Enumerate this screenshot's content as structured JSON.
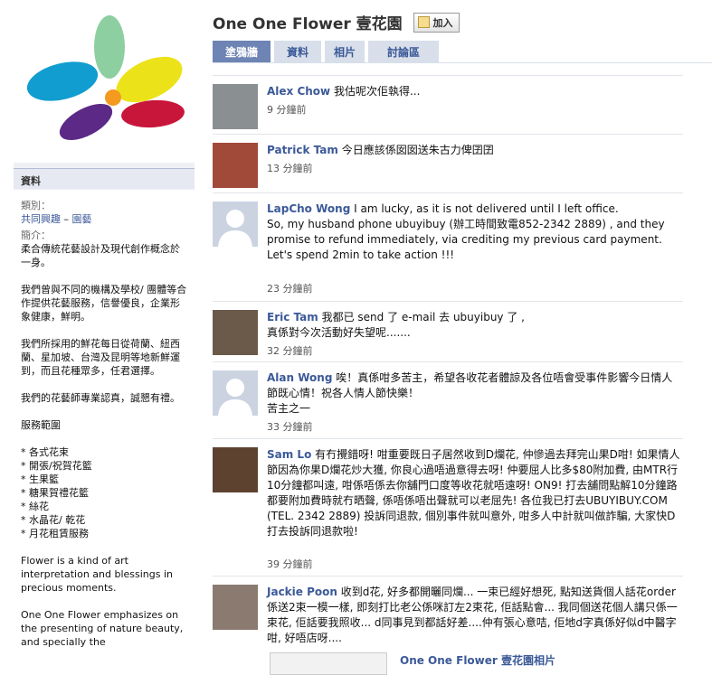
{
  "page": {
    "title": "One One Flower 壹花園",
    "join_label": "加入"
  },
  "tabs": [
    "塗鴉牆",
    "資料",
    "相片",
    "討論區"
  ],
  "info": {
    "header": "資料",
    "category_label": "類別：",
    "category_link1": "共同興趣",
    "category_sep": " – ",
    "category_link2": "園藝",
    "intro_label": "簡介：",
    "paragraphs": [
      "柔合傳統花藝設計及現代創作概念於一身。",
      "我們曾與不同的機構及學校/ 團體等合作提供花藝服務，信譽優良，企業形象健康，鮮明。",
      "我們所採用的鮮花每日從荷蘭、紐西蘭、星加坡、台灣及昆明等地新鮮運到，而且花種眾多，任君選擇。",
      "我們的花藝師專業認真，誠懇有禮。",
      "服務範圍",
      "* 各式花束\n* 開張/祝賀花籃\n* 生果籃\n* 糖果賀禮花籃\n* 絲花\n* 水晶花/ 乾花\n* 月花租賃服務",
      "Flower is a kind of art interpretation and blessings in precious moments.",
      "One One Flower emphasizes on the presenting of nature beauty, and specially the"
    ]
  },
  "posts": [
    {
      "name": "Alex Chow",
      "text": "我估呢次佢執得...",
      "time": "9 分鐘前"
    },
    {
      "name": "Patrick Tam",
      "text": "今日應該係囡囡送朱古力俾囝囝",
      "time": "13 分鐘前"
    },
    {
      "name": "LapCho Wong",
      "text": "I am lucky, as it is not delivered until I left office.\nSo, my husband phone ubuyibuy (辦工時間致電852-2342 2889) , and they promise to refund immediately, via crediting my previous card payment.\nLet's spend 2min to take action !!!",
      "time": "23 分鐘前"
    },
    {
      "name": "Eric Tam",
      "text": "我都已 send 了 e-mail 去 ubuyibuy 了 ,\n真係對今次活動好失望呢.......",
      "time": "32 分鐘前"
    },
    {
      "name": "Alan Wong",
      "text": "唉！真係咁多苦主，希望各收花者體諒及各位唔會受事件影響今日情人節既心情！祝各人情人節快樂！\n苦主之一",
      "time": "33 分鐘前"
    },
    {
      "name": "Sam Lo",
      "text": "有冇攪錯呀! 咁重要既日子居然收到D爛花, 仲慘過去拜完山果D咁! 如果情人節因為你果D爛花炒大獲, 你良心過唔過意得去呀! 仲要屈人比多$80附加費, 由MTR行10分鐘都叫遠, 咁係唔係去你舖門口度等收花就唔遠呀! ON9! 打去舖問點解10分鐘路都要附加費時就冇晒聲, 係唔係唔出聲就可以老屈先! 各位我已打去UBUYIBUY.COM (TEL. 2342 2889) 投訴同退款, 個別事件就叫意外, 咁多人中計就叫做詐騙, 大家快D打去投訴同退款啦!",
      "time": "39 分鐘前"
    },
    {
      "name": "Jackie Poon",
      "text": "收到d花, 好多都開曬同爛... 一束已經好想死, 點知送貨個人話花order 係送2束一模一樣, 即刻打比老公係咪訂左2束花, 佢話點會... 我同個送花個人講只係一束花, 佢話要我照收... d同事見到都話好差....仲有張心意咭, 佢地d字真係好似d中醫字咁, 好唔店呀....",
      "time": ""
    }
  ],
  "album_link": "One One Flower 壹花園相片",
  "colors": {
    "link": "#3b5998",
    "tab_active": "#6d84b4",
    "tab_inactive": "#d8dfea",
    "sidebar_bg": "#eef0f6"
  }
}
